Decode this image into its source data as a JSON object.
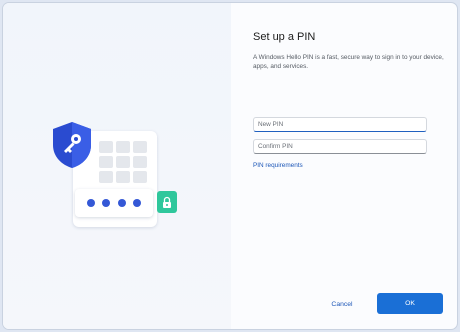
{
  "dialog": {
    "title": "Set up a PIN",
    "description": "A Windows Hello PIN is a fast, secure way to sign in to your device, apps, and services."
  },
  "form": {
    "new_pin_placeholder": "New PIN",
    "new_pin_value": "",
    "confirm_pin_placeholder": "Confirm PIN",
    "confirm_pin_value": "",
    "requirements_link": "PIN requirements"
  },
  "buttons": {
    "cancel_label": "Cancel",
    "ok_label": "OK"
  },
  "illustration": {
    "shield_icon": "shield-key-icon",
    "lock_icon": "lock-icon",
    "pin_dots_count": 4
  },
  "colors": {
    "accent": "#1a6fd6",
    "link": "#1d57b8",
    "shield": "#2a4bd0",
    "lock_badge": "#2fc79c",
    "pin_dot": "#3458d6"
  }
}
